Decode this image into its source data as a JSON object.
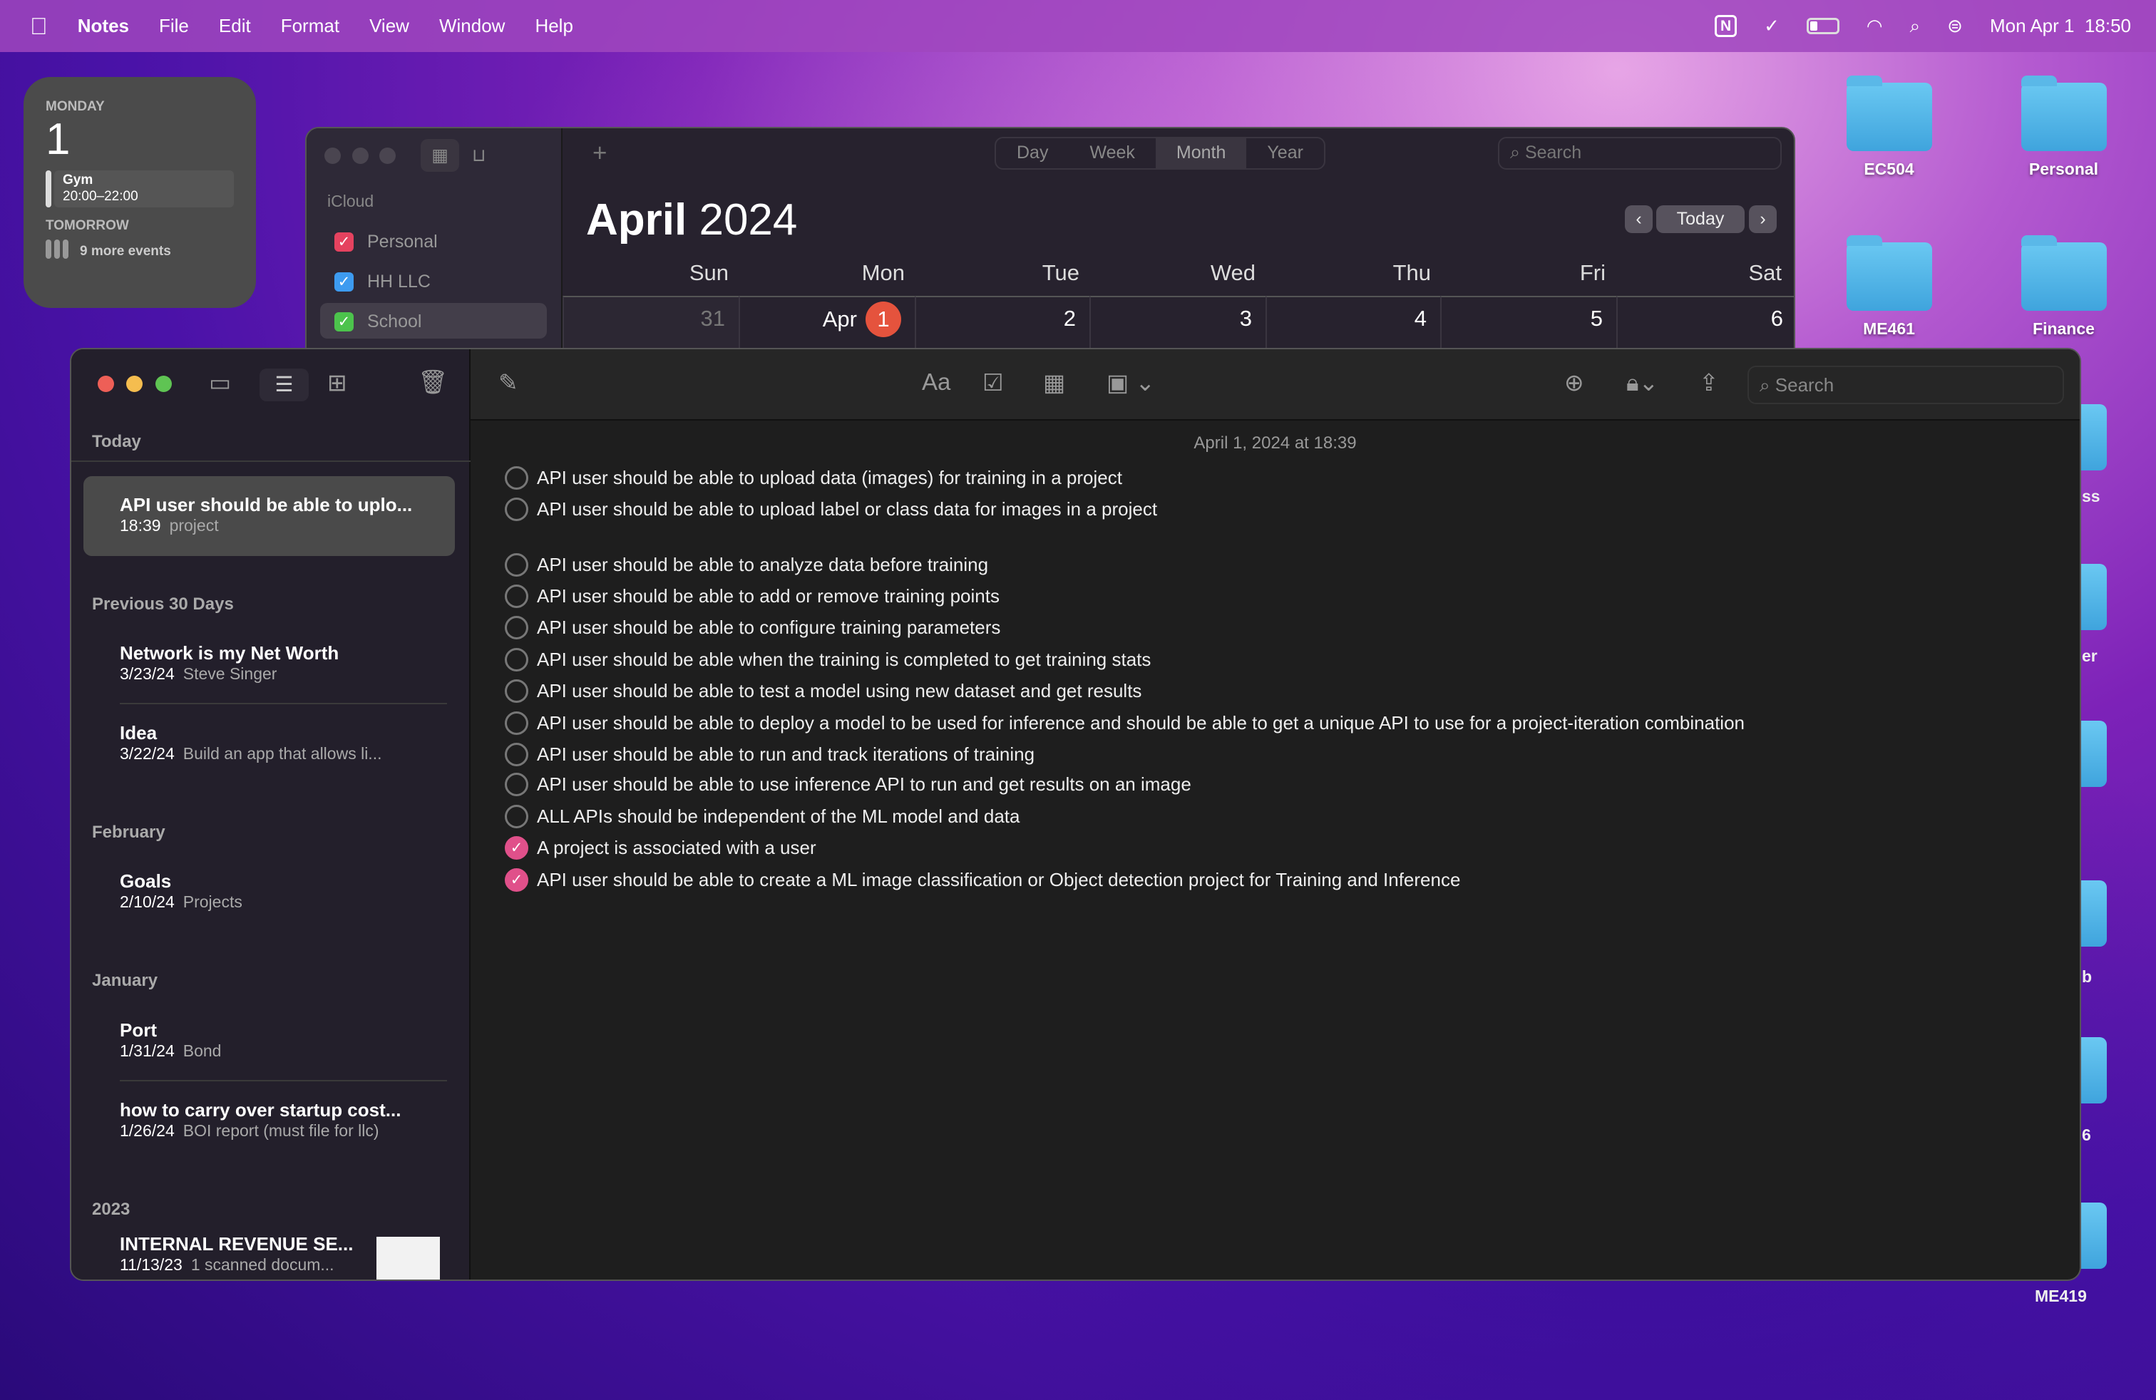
{
  "menubar": {
    "app": "Notes",
    "items": [
      "File",
      "Edit",
      "Format",
      "View",
      "Window",
      "Help"
    ],
    "clock": "Mon Apr 1  18:50",
    "icons": [
      "apple-icon",
      "notion-icon",
      "sync-error-icon",
      "battery-icon",
      "wifi-icon",
      "spotlight-search-icon",
      "control-center-icon"
    ]
  },
  "widget": {
    "weekday": "MONDAY",
    "day": "1",
    "event_title": "Gym",
    "event_time": "20:00–22:00",
    "tomorrow": "TOMORROW",
    "more": "9 more events"
  },
  "desktop": {
    "folders": [
      "EC504",
      "Personal",
      "ME461",
      "Finance"
    ],
    "partial_labels": [
      "ss",
      "er",
      "b",
      "6",
      "ME419"
    ]
  },
  "calendar": {
    "group": "iCloud",
    "calendars": [
      {
        "name": "Personal",
        "color": "#e5425f"
      },
      {
        "name": "HH LLC",
        "color": "#3d9bf0"
      },
      {
        "name": "School",
        "color": "#4cc34c"
      }
    ],
    "views": [
      "Day",
      "Week",
      "Month",
      "Year"
    ],
    "active_view": "Month",
    "search_placeholder": "Search",
    "month": "April",
    "year": "2024",
    "today_label": "Today",
    "weekdays": [
      "Sun",
      "Mon",
      "Tue",
      "Wed",
      "Thu",
      "Fri",
      "Sat"
    ],
    "first_row": [
      "31",
      "Apr",
      "2",
      "3",
      "4",
      "5",
      "6"
    ],
    "today_num": "1"
  },
  "notes": {
    "search_placeholder": "Search",
    "note_date": "April 1, 2024 at 18:39",
    "sections": [
      {
        "label": "Today",
        "notes": [
          {
            "title": "API user should be able to uplo...",
            "date": "18:39",
            "preview": "project"
          }
        ]
      },
      {
        "label": "Previous 30 Days",
        "notes": [
          {
            "title": "Network is my Net Worth",
            "date": "3/23/24",
            "preview": "Steve Singer"
          },
          {
            "title": "Idea",
            "date": "3/22/24",
            "preview": "Build an app that allows li..."
          }
        ]
      },
      {
        "label": "February",
        "notes": [
          {
            "title": "Goals",
            "date": "2/10/24",
            "preview": "Projects"
          }
        ]
      },
      {
        "label": "January",
        "notes": [
          {
            "title": "Port",
            "date": "1/31/24",
            "preview": "Bond"
          },
          {
            "title": "how to carry over startup cost...",
            "date": "1/26/24",
            "preview": "BOI report (must file for llc)"
          }
        ]
      },
      {
        "label": "2023",
        "notes": [
          {
            "title": "INTERNAL REVENUE SE...",
            "date": "11/13/23",
            "preview": "1 scanned docum..."
          }
        ]
      }
    ],
    "checklist": [
      {
        "text": "API user should be able to upload data (images) for training in a project",
        "done": false
      },
      {
        "text": "API user should be able to upload label or class data for images in a project",
        "done": false
      },
      {
        "text": "API user should be able to analyze data before training",
        "done": false
      },
      {
        "text": "API user should be able to add or remove training points",
        "done": false
      },
      {
        "text": "API user should be able to configure training parameters",
        "done": false
      },
      {
        "text": "API user should be able when the training is completed to get training stats",
        "done": false
      },
      {
        "text": "API user should be able to test a model using new dataset and get results",
        "done": false
      },
      {
        "text": "API user should be able to deploy a model to be used for inference and should be able to get a unique API to use for a project-iteration combination",
        "done": false
      },
      {
        "text": "API user should be able to run and track iterations of training",
        "done": false
      },
      {
        "text": "API user should be able to use inference API to run and get results on an image",
        "done": false
      },
      {
        "text": "ALL APIs should be independent of the ML model and data",
        "done": false
      },
      {
        "text": "A project is associated with a user",
        "done": true
      },
      {
        "text": "API user should be able to create a ML image classification or Object detection project for Training and Inference",
        "done": true
      }
    ],
    "accent": "#e0508a"
  }
}
